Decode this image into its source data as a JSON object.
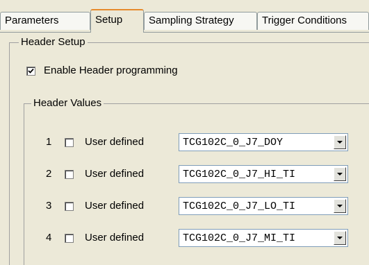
{
  "tabs": [
    "Parameters",
    "Setup",
    "Sampling Strategy",
    "Trigger Conditions"
  ],
  "header_setup": {
    "title": "Header Setup",
    "enable_label": "Enable Header programming",
    "enable_checked": true
  },
  "header_values": {
    "title": "Header Values",
    "rows": [
      {
        "index": "1",
        "user_defined_label": "User defined",
        "user_defined_checked": false,
        "value": "TCG102C_0_J7_DOY"
      },
      {
        "index": "2",
        "user_defined_label": "User defined",
        "user_defined_checked": false,
        "value": "TCG102C_0_J7_HI_TI"
      },
      {
        "index": "3",
        "user_defined_label": "User defined",
        "user_defined_checked": false,
        "value": "TCG102C_0_J7_LO_TI"
      },
      {
        "index": "4",
        "user_defined_label": "User defined",
        "user_defined_checked": false,
        "value": "TCG102C_0_J7_MI_TI"
      }
    ]
  }
}
